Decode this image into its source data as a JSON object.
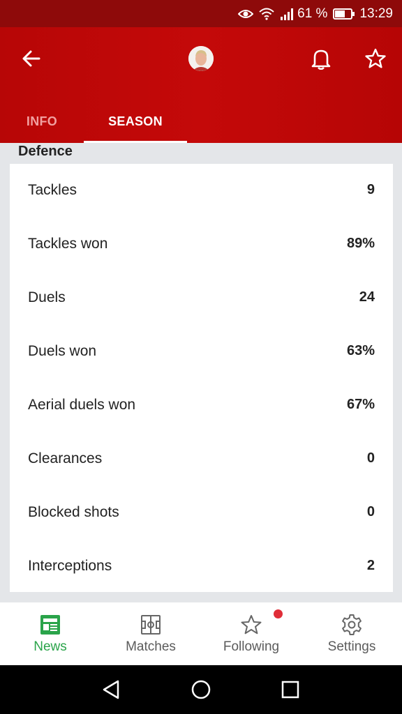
{
  "status_bar": {
    "battery_percent": "61 %",
    "time": "13:29",
    "icons": [
      "eye-icon",
      "wifi-icon",
      "signal-icon",
      "battery-icon"
    ]
  },
  "header": {
    "icons": [
      "back-arrow-icon",
      "player-avatar",
      "bell-icon",
      "star-icon"
    ],
    "tabs": [
      {
        "label": "INFO",
        "active": false
      },
      {
        "label": "SEASON",
        "active": true
      }
    ]
  },
  "section": {
    "title": "Defence",
    "stats": [
      {
        "label": "Tackles",
        "value": "9"
      },
      {
        "label": "Tackles won",
        "value": "89%"
      },
      {
        "label": "Duels",
        "value": "24"
      },
      {
        "label": "Duels won",
        "value": "63%"
      },
      {
        "label": "Aerial duels won",
        "value": "67%"
      },
      {
        "label": "Clearances",
        "value": "0"
      },
      {
        "label": "Blocked shots",
        "value": "0"
      },
      {
        "label": "Interceptions",
        "value": "2"
      }
    ]
  },
  "bottom_nav": {
    "items": [
      {
        "label": "News",
        "icon": "news-icon",
        "active": true
      },
      {
        "label": "Matches",
        "icon": "pitch-icon",
        "active": false
      },
      {
        "label": "Following",
        "icon": "star-outline-icon",
        "active": false,
        "badge": true
      },
      {
        "label": "Settings",
        "icon": "gear-icon",
        "active": false
      }
    ]
  },
  "colors": {
    "header_red": "#c40909",
    "status_bar": "#8e0a0a",
    "active_green": "#2aa44a",
    "badge_red": "#e02d38",
    "background": "#e4e6e9"
  }
}
